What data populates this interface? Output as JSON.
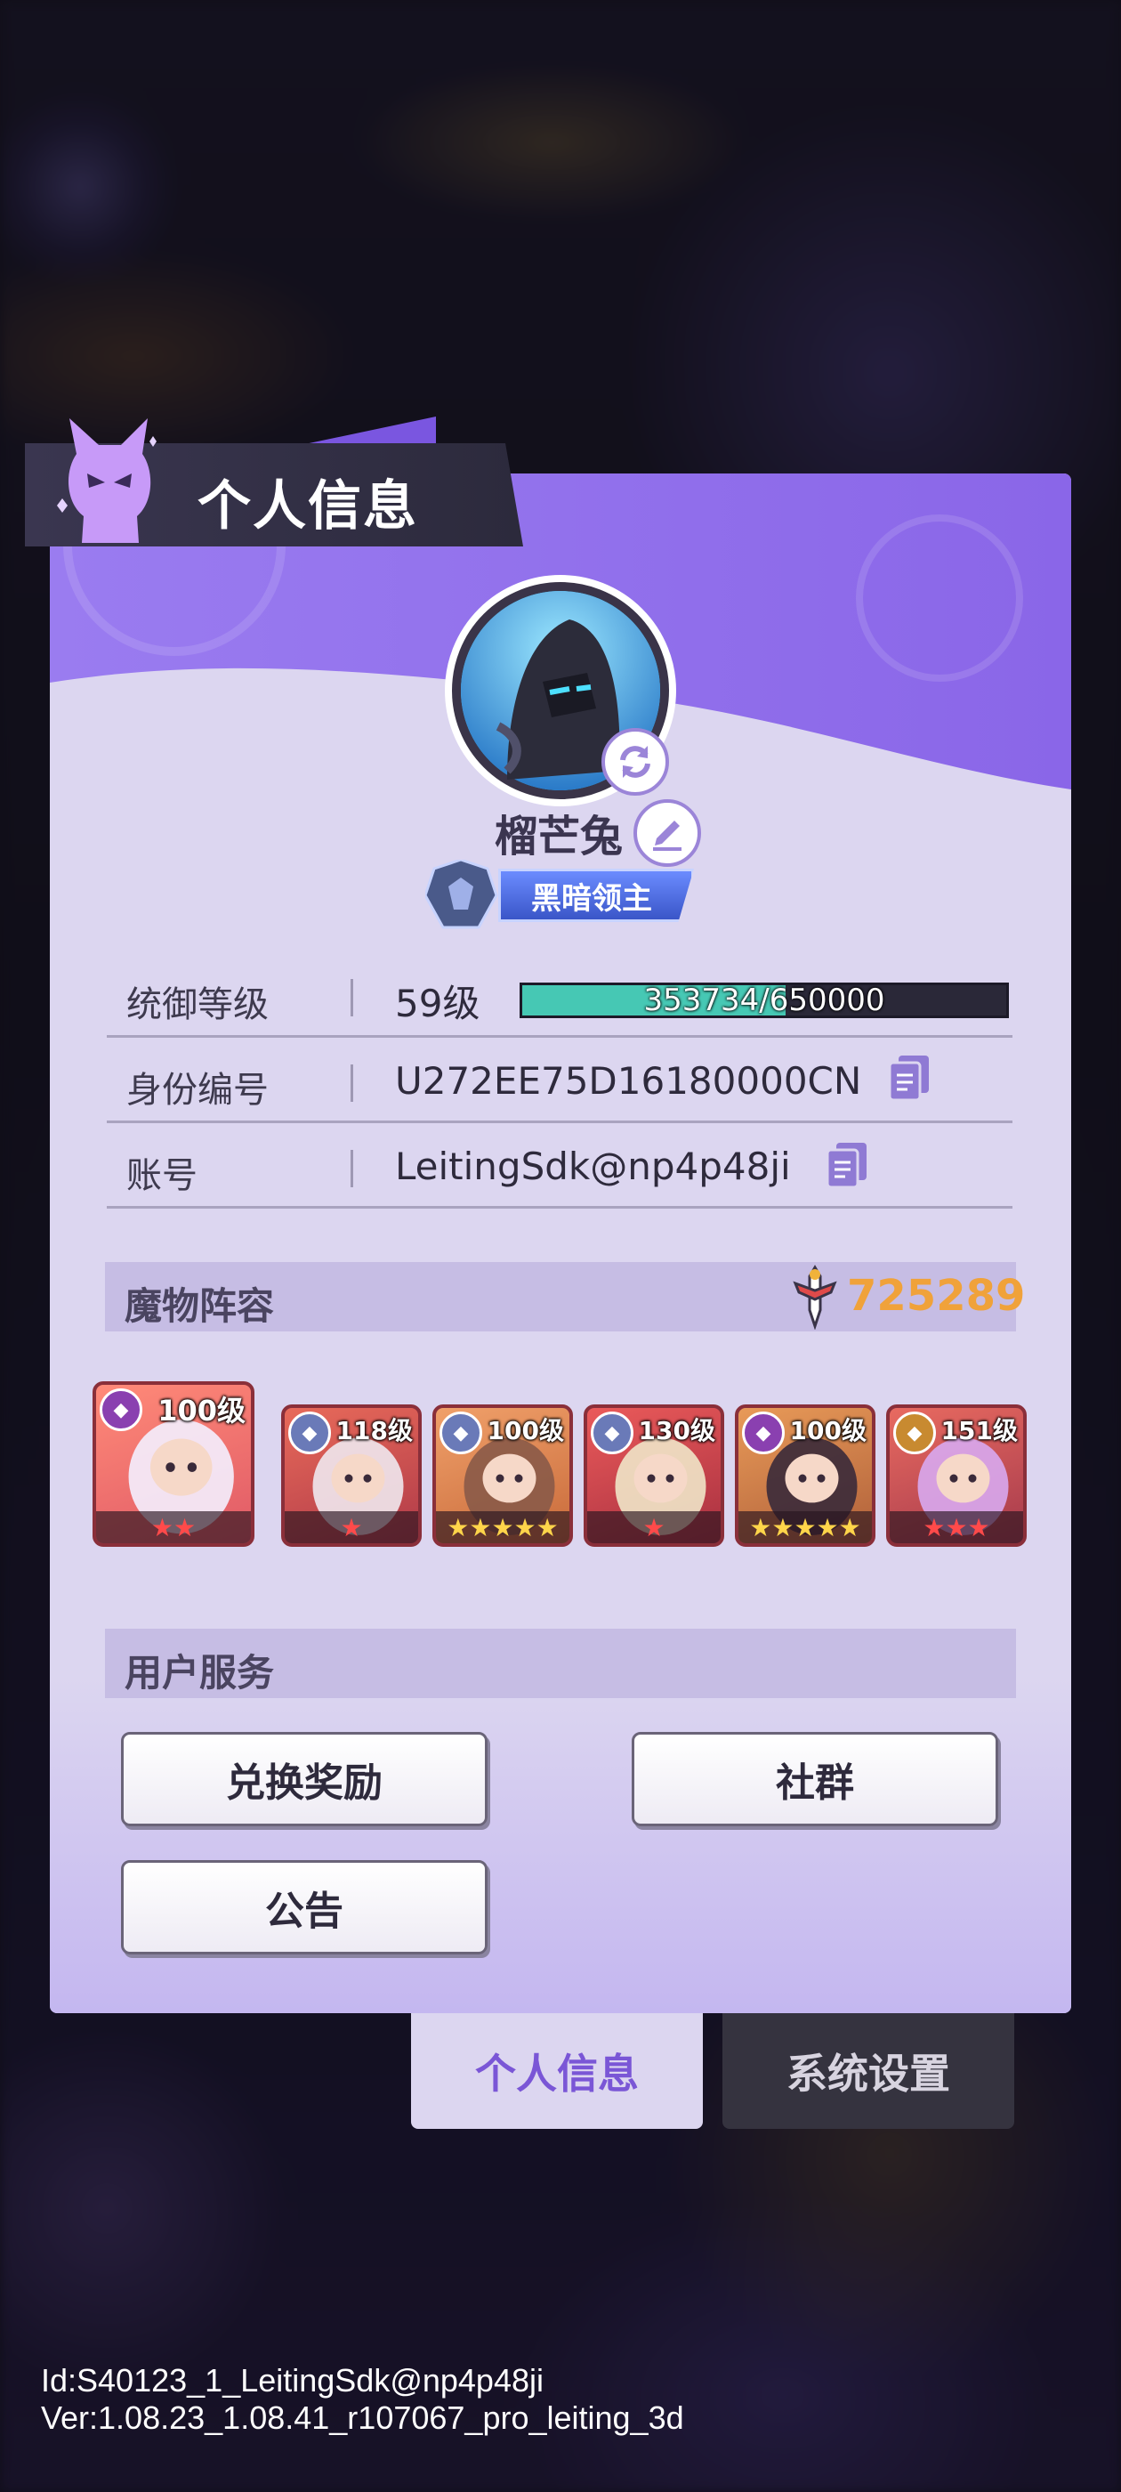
{
  "header": {
    "title": "个人信息"
  },
  "profile": {
    "name": "榴芒兔",
    "title_badge": "黑暗领主"
  },
  "info": {
    "level": {
      "label": "统御等级",
      "value": "59级",
      "exp_text": "353734/650000",
      "exp_current": 353734,
      "exp_max": 650000
    },
    "id": {
      "label": "身份编号",
      "value": "U272EE75D16180000CN"
    },
    "account": {
      "label": "账号",
      "value": "LeitingSdk@np4p48ji"
    }
  },
  "lineup": {
    "title": "魔物阵容",
    "power": "725289",
    "monsters": [
      {
        "level": "100级",
        "stars": 2,
        "star_color": "red"
      },
      {
        "level": "118级",
        "stars": 1,
        "star_color": "red"
      },
      {
        "level": "100级",
        "stars": 5,
        "star_color": "gold"
      },
      {
        "level": "130级",
        "stars": 1,
        "star_color": "red"
      },
      {
        "level": "100级",
        "stars": 5,
        "star_color": "gold"
      },
      {
        "level": "151级",
        "stars": 3,
        "star_color": "red"
      }
    ]
  },
  "services": {
    "title": "用户服务",
    "buttons": {
      "redeem": "兑换奖励",
      "community": "社群",
      "notice": "公告"
    }
  },
  "tabs": {
    "profile": "个人信息",
    "settings": "系统设置"
  },
  "footer": {
    "id_line": "Id:S40123_1_LeitingSdk@np4p48ji",
    "version_line": "Ver:1.08.23_1.08.41_r107067_pro_leiting_3d"
  },
  "colors": {
    "accent_purple": "#7a56e0",
    "panel": "#dcd6f0",
    "exp_fill": "#46c8b4",
    "power_orange": "#f0a23a"
  }
}
